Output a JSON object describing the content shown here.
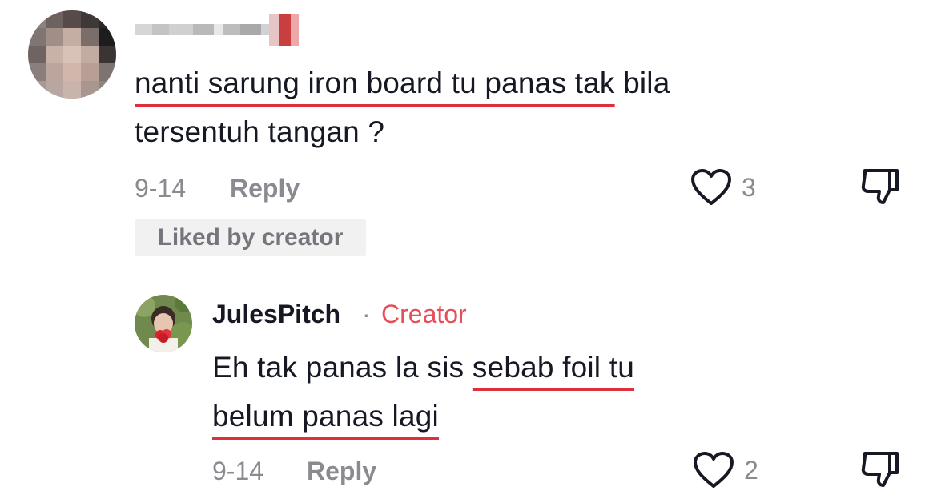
{
  "comment": {
    "text_prefix": "",
    "text_underlined": "nanti sarung iron board tu panas tak",
    "text_rest_line1": " bila",
    "text_line2": "tersentuh tangan ?",
    "date": "9-14",
    "reply_label": "Reply",
    "like_count": "3",
    "liked_badge": "Liked by creator"
  },
  "reply": {
    "username": "JulesPitch",
    "separator": "·",
    "badge": "Creator",
    "text_plain": "Eh tak panas la sis ",
    "text_underlined_1": "sebab foil tu",
    "text_underlined_2": "belum panas lagi",
    "date": "9-14",
    "reply_label": "Reply",
    "like_count": "2"
  },
  "icons": {
    "like": "heart-outline-icon",
    "dislike": "thumbs-down-icon"
  },
  "colors": {
    "text": "#161823",
    "muted": "#8a8b91",
    "creator_badge": "#e64f5a",
    "underline": "#e02f3c",
    "liked_badge_bg": "#f1f1f2"
  }
}
